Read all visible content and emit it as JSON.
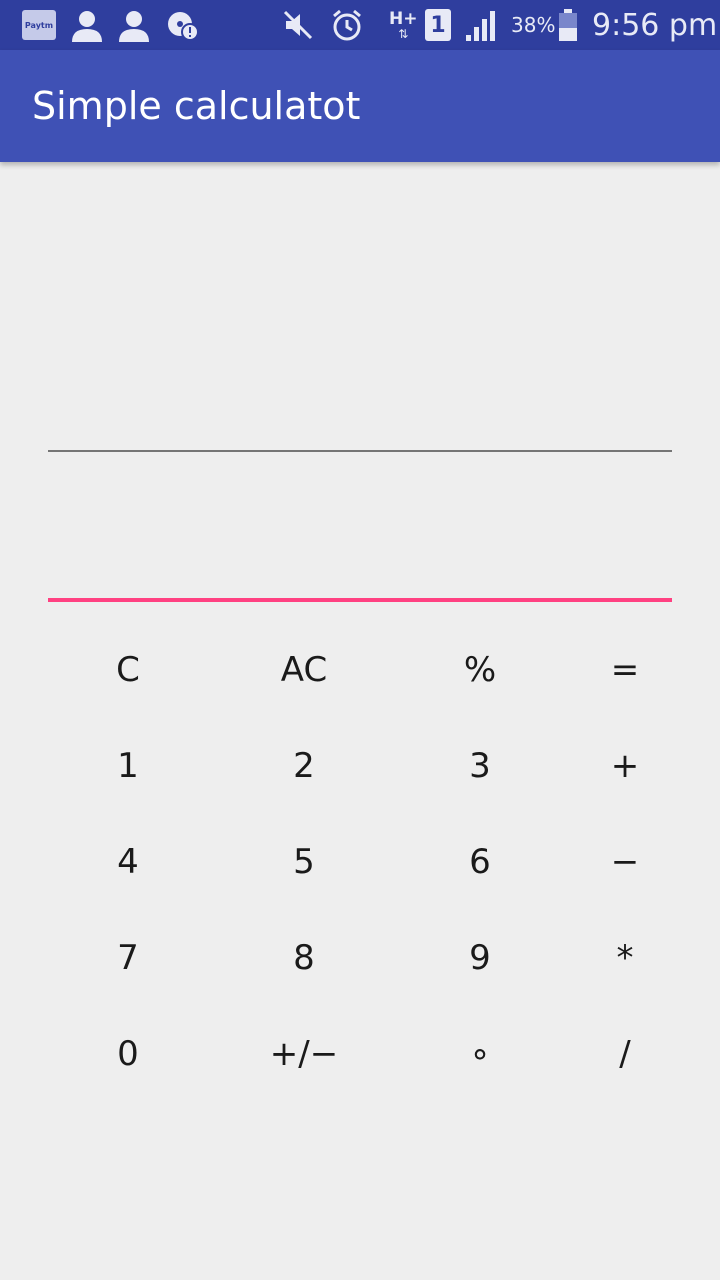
{
  "status_bar": {
    "paytm_label": "Paytm",
    "battery_percent": "38%",
    "sim_slot": "1",
    "network_type": "H+",
    "time": "9:56 pm",
    "icons": [
      "paytm-icon",
      "person-icon",
      "person-icon",
      "data-alert-icon",
      "vibrate-off-icon",
      "alarm-icon",
      "network-hplus-icon",
      "sim-1-icon",
      "signal-icon",
      "battery-icon"
    ]
  },
  "app_bar": {
    "title": "Simple calculatot",
    "color": "#3f51b5",
    "status_color": "#2f3e9e"
  },
  "inputs": {
    "first_value": "",
    "second_value": "",
    "accent_color": "#ff4081"
  },
  "keypad": {
    "rows": [
      [
        "C",
        "AC",
        "%",
        "="
      ],
      [
        "1",
        "2",
        "3",
        "+"
      ],
      [
        "4",
        "5",
        "6",
        "−"
      ],
      [
        "7",
        "8",
        "9",
        "*"
      ],
      [
        "0",
        "+/−",
        "∘",
        "/"
      ]
    ]
  }
}
